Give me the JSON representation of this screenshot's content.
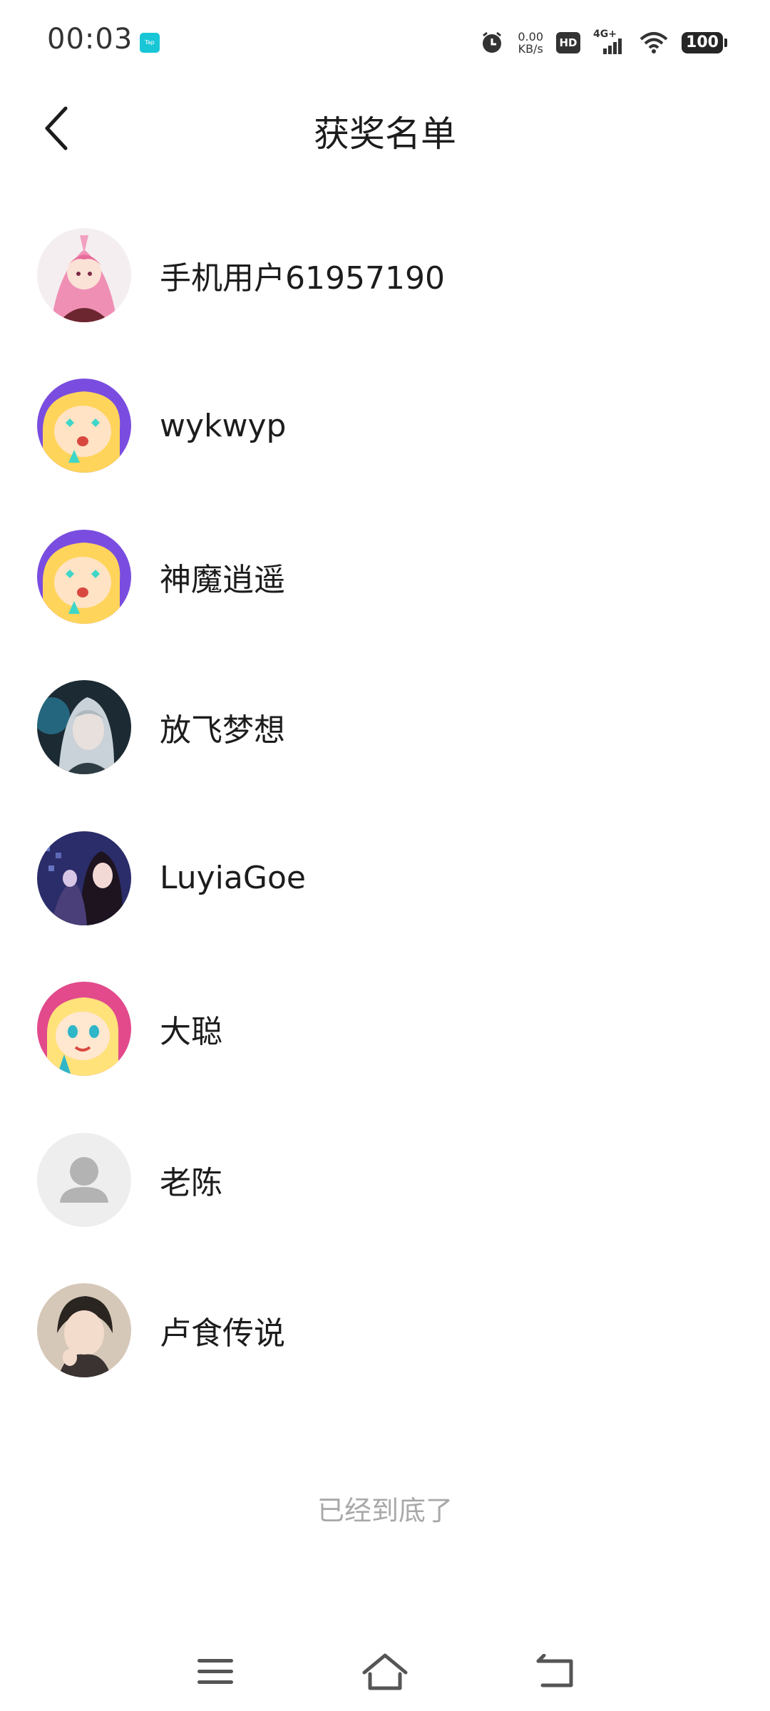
{
  "status_bar": {
    "time": "00:03",
    "app_badge": "Tap",
    "net_speed_value": "0.00",
    "net_speed_unit": "KB/s",
    "hd_label": "HD",
    "network_type": "4G+",
    "battery": "100"
  },
  "header": {
    "title": "获奖名单"
  },
  "winners": [
    {
      "name": "手机用户61957190",
      "avatar": "anime-pink-hair-avatar"
    },
    {
      "name": "wykwyp",
      "avatar": "default-cartoon-purple-avatar"
    },
    {
      "name": "神魔逍遥",
      "avatar": "default-cartoon-purple-avatar"
    },
    {
      "name": "放飞梦想",
      "avatar": "anime-silver-hair-avatar"
    },
    {
      "name": "LuyiaGoe",
      "avatar": "anime-dark-night-avatar"
    },
    {
      "name": "大聪",
      "avatar": "default-cartoon-pink-avatar"
    },
    {
      "name": "老陈",
      "avatar": "default-person-avatar"
    },
    {
      "name": "卢食传说",
      "avatar": "anime-dark-hair-avatar"
    }
  ],
  "end_text": "已经到底了",
  "colors": {
    "title": "#1c1c1c",
    "end_text": "#a8a8a8",
    "cartoon_purple": "#7a4de0",
    "cartoon_pink": "#e24a8c"
  }
}
